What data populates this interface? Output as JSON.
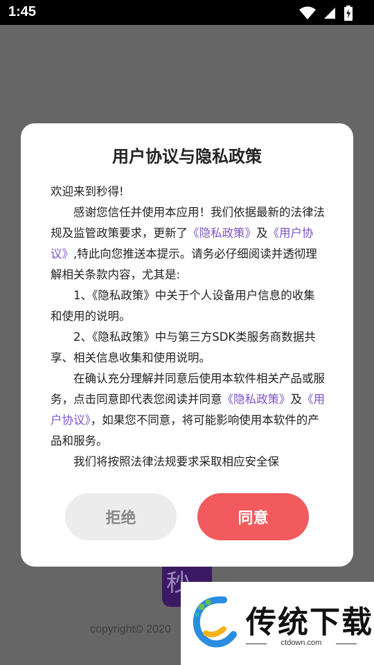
{
  "status_bar": {
    "time": "1:45",
    "icons": [
      "wifi-icon",
      "signal-icon",
      "battery-charging-icon"
    ]
  },
  "background": {
    "logo_glyph": "秒",
    "copyright": "copyright© 2020"
  },
  "dialog": {
    "title": "用户协议与隐私政策",
    "greeting": "欢迎来到秒得!",
    "para1_a": "感谢您信任并使用本应用！我们依据最新的法律法规及监管政策要求，更新了",
    "link_privacy": "《隐私政策》",
    "and": "及",
    "link_agreement": "《用户协议》",
    "para1_b": ",特此向您推送本提示。请务必仔细阅读并透彻理解相关条款内容，尤其是:",
    "item1_a": "1、",
    "item1_link": "《隐私政策》",
    "item1_b": "中关于个人设备用户信息的收集和使用的说明。",
    "item2_a": "2、",
    "item2_link": "《隐私政策》",
    "item2_b": "中与第三方SDK类服务商数据共享、相关信息收集和使用说明。",
    "para3_a": "在确认充分理解并同意后使用本软件相关产品或服务，点击同意即代表您阅读并同意",
    "para3_b": "，如果您不同意，将可能影响使用本软件的产品和服务。",
    "para4": "我们将按照法律法规要求采取相应安全保",
    "reject_label": "拒绝",
    "agree_label": "同意"
  },
  "watermark": {
    "brand": "传统下载",
    "url": "ctdown.com"
  },
  "colors": {
    "link": "#7b53c9",
    "agree_button": "#f25a5e",
    "reject_button": "#ececec",
    "overlay": "#666666"
  }
}
